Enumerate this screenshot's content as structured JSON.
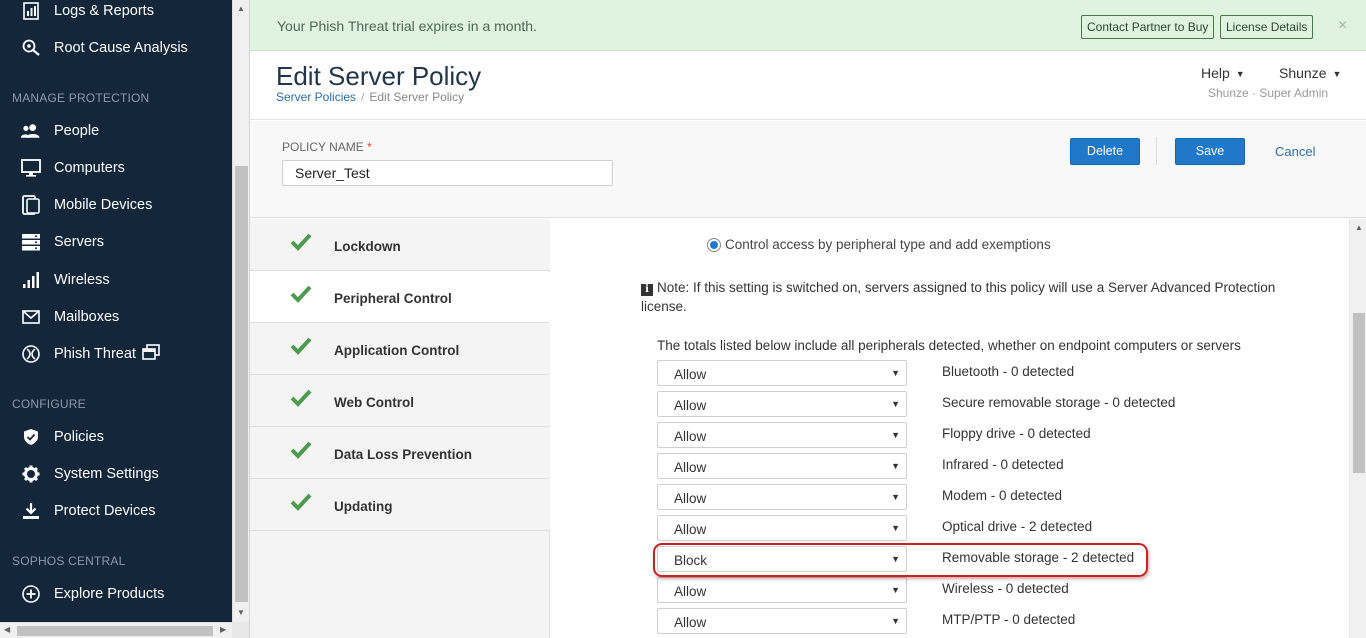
{
  "sidebar": {
    "top_items": [
      {
        "label": "Logs & Reports",
        "icon": "logs-reports-icon"
      },
      {
        "label": "Root Cause Analysis",
        "icon": "root-cause-icon"
      }
    ],
    "sections": [
      {
        "title": "MANAGE PROTECTION",
        "items": [
          {
            "label": "People",
            "icon": "people-icon"
          },
          {
            "label": "Computers",
            "icon": "computer-icon"
          },
          {
            "label": "Mobile Devices",
            "icon": "mobile-icon"
          },
          {
            "label": "Servers",
            "icon": "server-icon"
          },
          {
            "label": "Wireless",
            "icon": "wireless-icon"
          },
          {
            "label": "Mailboxes",
            "icon": "mail-icon"
          },
          {
            "label": "Phish Threat",
            "icon": "phish-icon",
            "extra_icon": "external-window-icon"
          }
        ]
      },
      {
        "title": "CONFIGURE",
        "items": [
          {
            "label": "Policies",
            "icon": "shield-icon"
          },
          {
            "label": "System Settings",
            "icon": "gear-icon"
          },
          {
            "label": "Protect Devices",
            "icon": "download-icon"
          }
        ]
      },
      {
        "title": "SOPHOS CENTRAL",
        "items": [
          {
            "label": "Explore Products",
            "icon": "plus-circle-icon"
          }
        ]
      }
    ]
  },
  "banner": {
    "message": "Your Phish Threat trial expires in a month.",
    "contact_label": "Contact Partner to Buy",
    "license_label": "License Details",
    "close_glyph": "×"
  },
  "header": {
    "title": "Edit Server Policy",
    "breadcrumb_link": "Server Policies",
    "breadcrumb_sep": "/",
    "breadcrumb_current": "Edit Server Policy",
    "help_label": "Help",
    "user_label": "Shunze",
    "role_label": "Shunze · Super Admin"
  },
  "form": {
    "policy_name_label": "POLICY NAME",
    "required_mark": "*",
    "policy_name_value": "Server_Test",
    "delete_label": "Delete",
    "save_label": "Save",
    "cancel_label": "Cancel"
  },
  "tabs": [
    {
      "label": "Lockdown",
      "active": false
    },
    {
      "label": "Peripheral Control",
      "active": true
    },
    {
      "label": "Application Control",
      "active": false
    },
    {
      "label": "Web Control",
      "active": false
    },
    {
      "label": "Data Loss Prevention",
      "active": false
    },
    {
      "label": "Updating",
      "active": false
    }
  ],
  "content": {
    "radio_label": "Control access by peripheral type and add exemptions",
    "note_text": "Note: If this setting is switched on, servers assigned to this policy will use a Server Advanced Protection license.",
    "totals_text": "The totals listed below include all peripherals detected, whether on endpoint computers or servers",
    "peripherals": [
      {
        "setting": "Allow",
        "name": "Bluetooth - 0 detected"
      },
      {
        "setting": "Allow",
        "name": "Secure removable storage - 0 detected"
      },
      {
        "setting": "Allow",
        "name": "Floppy drive - 0 detected"
      },
      {
        "setting": "Allow",
        "name": "Infrared - 0 detected"
      },
      {
        "setting": "Allow",
        "name": "Modem - 0 detected"
      },
      {
        "setting": "Allow",
        "name": "Optical drive - 2 detected"
      },
      {
        "setting": "Block",
        "name": "Removable storage - 2 detected",
        "highlighted": true
      },
      {
        "setting": "Allow",
        "name": "Wireless - 0 detected"
      },
      {
        "setting": "Allow",
        "name": "MTP/PTP - 0 detected"
      }
    ]
  },
  "colors": {
    "sidebar_bg": "#13263a",
    "accent_blue": "#1f78c8",
    "check_green": "#4e9a4e",
    "banner_bg": "#e0f2e0",
    "highlight_red": "#c92222"
  }
}
